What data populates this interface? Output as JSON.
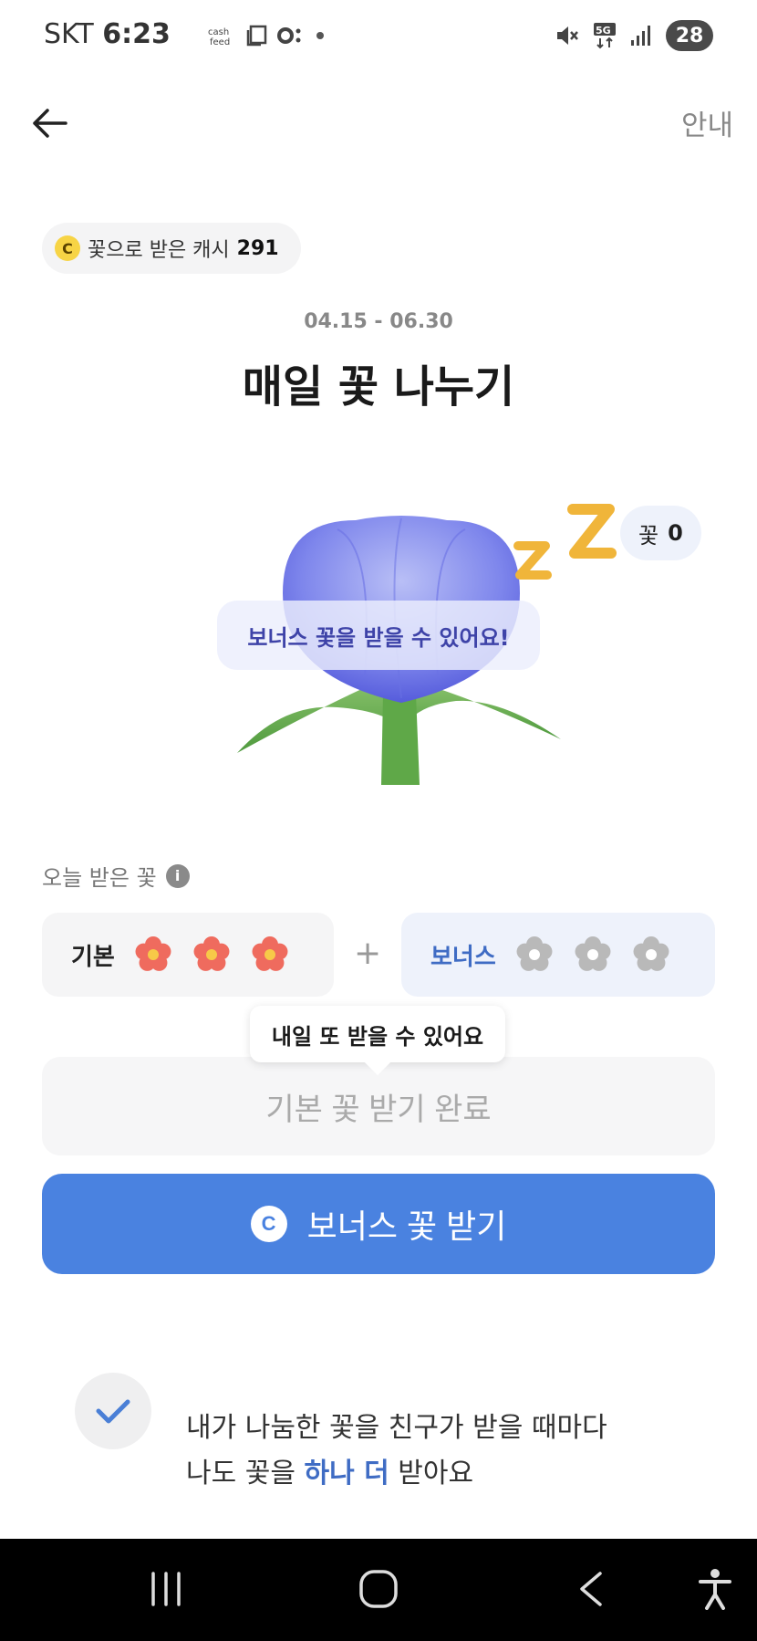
{
  "status_bar": {
    "carrier": "SKT",
    "time": "6:23",
    "battery": "28",
    "network": "5G"
  },
  "header": {
    "guide_label": "안내"
  },
  "cash_summary": {
    "coin_symbol": "C",
    "label": "꽃으로 받은 캐시",
    "amount": "291"
  },
  "event": {
    "date_range": "04.15 - 06.30",
    "title": "매일 꽃 나누기"
  },
  "illustration": {
    "flower_count_label": "꽃",
    "flower_count": "0",
    "bubble_text": "보너스 꽃을 받을 수 있어요!"
  },
  "today": {
    "label": "오늘 받은 꽃",
    "info_symbol": "i",
    "basic_label": "기본",
    "basic_received": 3,
    "basic_total": 3,
    "plus": "+",
    "bonus_label": "보너스",
    "bonus_received": 0,
    "bonus_total": 3
  },
  "tooltip": {
    "text": "내일 또 받을 수 있어요"
  },
  "buttons": {
    "basic_done": "기본 꽃 받기 완료",
    "bonus_coin": "C",
    "bonus_claim": "보너스 꽃 받기"
  },
  "notice": {
    "line1": "내가 나눔한 꽃을 친구가 받을 때마다",
    "line2_prefix": "나도 꽃을 ",
    "line2_highlight": "하나 더",
    "line2_suffix": " 받아요"
  },
  "colors": {
    "accent": "#4a82e0",
    "bonus_text": "#3f6cc4",
    "flower_active": "#ef6b5e",
    "flower_center": "#f7c948",
    "flower_inactive": "#b9b9b9"
  }
}
